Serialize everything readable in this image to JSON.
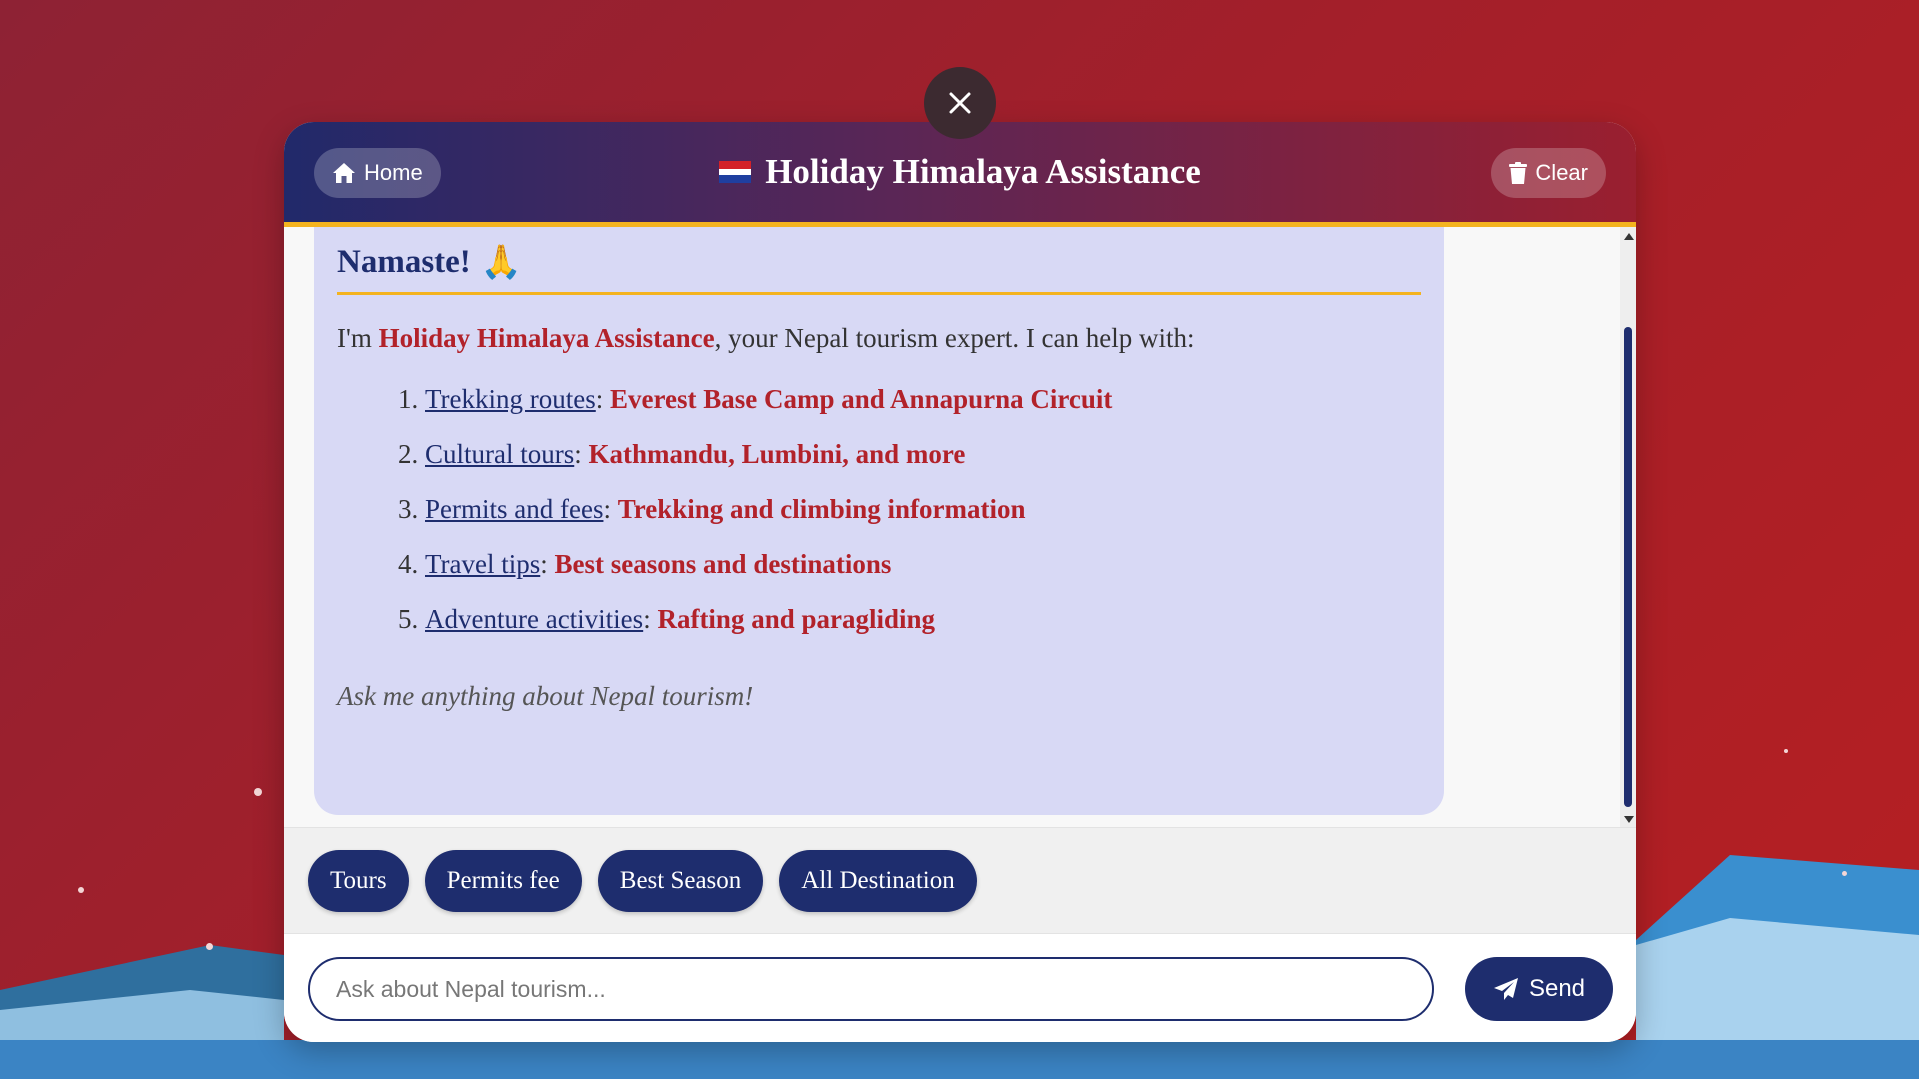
{
  "header": {
    "home_label": "Home",
    "title": "Holiday Himalaya Assistance",
    "clear_label": "Clear"
  },
  "message": {
    "greeting": "Namaste!",
    "greeting_emoji": "🙏",
    "intro_prefix": "I'm ",
    "intro_brand": "Holiday Himalaya Assistance",
    "intro_suffix": ", your Nepal tourism expert. I can help with:",
    "items": [
      {
        "topic": "Trekking routes",
        "detail": "Everest Base Camp and Annapurna Circuit"
      },
      {
        "topic": "Cultural tours",
        "detail": "Kathmandu, Lumbini, and more"
      },
      {
        "topic": "Permits and fees",
        "detail": "Trekking and climbing information"
      },
      {
        "topic": "Travel tips",
        "detail": "Best seasons and destinations"
      },
      {
        "topic": "Adventure activities",
        "detail": "Rafting and paragliding"
      }
    ],
    "outro": "Ask me anything about Nepal tourism!"
  },
  "quick_replies": [
    "Tours",
    "Permits fee",
    "Best Season",
    "All Destination"
  ],
  "input": {
    "placeholder": "Ask about Nepal tourism...",
    "value": ""
  },
  "send_label": "Send",
  "icons": {
    "close": "close-icon",
    "home": "home-icon",
    "clear": "trash-icon",
    "send": "paper-plane-icon",
    "flag": "flag-icon"
  },
  "colors": {
    "navy": "#1e2d6e",
    "crimson": "#b2222a",
    "gold": "#f4b31f",
    "bubble": "#d8d9f5"
  }
}
